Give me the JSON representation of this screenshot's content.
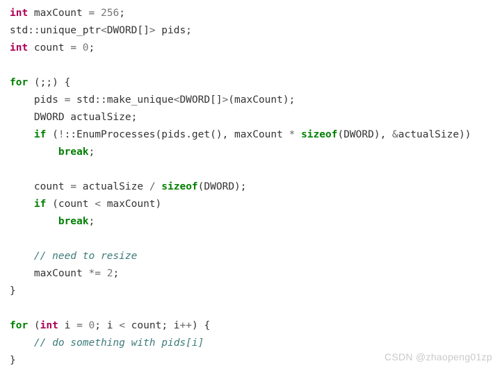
{
  "page": {
    "background_color": "#ffffff",
    "language": "cpp"
  },
  "theme": {
    "plain_color": "#333333",
    "keyword_color": "#008000",
    "type_color": "#aa0055",
    "number_color": "#777777",
    "operator_color": "#666666",
    "comment_color": "#3d7b7b",
    "watermark_color": "#c9c9c9"
  },
  "code": {
    "lines": [
      {
        "index": 0,
        "text": "int maxCount = 256;",
        "tokens": [
          {
            "t": "int",
            "k": "type"
          },
          {
            "t": " maxCount ",
            "k": "plain"
          },
          {
            "t": "=",
            "k": "operator"
          },
          {
            "t": " ",
            "k": "plain"
          },
          {
            "t": "256",
            "k": "number"
          },
          {
            "t": ";",
            "k": "punct"
          }
        ]
      },
      {
        "index": 1,
        "text": "std::unique_ptr<DWORD[]> pids;",
        "tokens": [
          {
            "t": "std::unique_ptr",
            "k": "plain"
          },
          {
            "t": "<",
            "k": "operator"
          },
          {
            "t": "DWORD[]",
            "k": "plain"
          },
          {
            "t": ">",
            "k": "operator"
          },
          {
            "t": " pids;",
            "k": "plain"
          }
        ]
      },
      {
        "index": 2,
        "text": "int count = 0;",
        "tokens": [
          {
            "t": "int",
            "k": "type"
          },
          {
            "t": " count ",
            "k": "plain"
          },
          {
            "t": "=",
            "k": "operator"
          },
          {
            "t": " ",
            "k": "plain"
          },
          {
            "t": "0",
            "k": "number"
          },
          {
            "t": ";",
            "k": "punct"
          }
        ]
      },
      {
        "index": 3,
        "text": "",
        "tokens": []
      },
      {
        "index": 4,
        "text": "for (;;) {",
        "tokens": [
          {
            "t": "for",
            "k": "keyword"
          },
          {
            "t": " (;;) {",
            "k": "plain"
          }
        ]
      },
      {
        "index": 5,
        "text": "    pids = std::make_unique<DWORD[]>(maxCount);",
        "tokens": [
          {
            "t": "    pids ",
            "k": "plain"
          },
          {
            "t": "=",
            "k": "operator"
          },
          {
            "t": " std::make_unique",
            "k": "plain"
          },
          {
            "t": "<",
            "k": "operator"
          },
          {
            "t": "DWORD[]",
            "k": "plain"
          },
          {
            "t": ">",
            "k": "operator"
          },
          {
            "t": "(maxCount);",
            "k": "plain"
          }
        ]
      },
      {
        "index": 6,
        "text": "    DWORD actualSize;",
        "tokens": [
          {
            "t": "    DWORD actualSize;",
            "k": "plain"
          }
        ]
      },
      {
        "index": 7,
        "text": "    if (!::EnumProcesses(pids.get(), maxCount * sizeof(DWORD), &actualSize))",
        "tokens": [
          {
            "t": "    ",
            "k": "plain"
          },
          {
            "t": "if",
            "k": "keyword"
          },
          {
            "t": " (",
            "k": "plain"
          },
          {
            "t": "!",
            "k": "operator"
          },
          {
            "t": "::EnumProcesses(pids.get(), maxCount ",
            "k": "plain"
          },
          {
            "t": "*",
            "k": "operator"
          },
          {
            "t": " ",
            "k": "plain"
          },
          {
            "t": "sizeof",
            "k": "keyword"
          },
          {
            "t": "(DWORD), ",
            "k": "plain"
          },
          {
            "t": "&",
            "k": "operator"
          },
          {
            "t": "actualSize))",
            "k": "plain"
          }
        ]
      },
      {
        "index": 8,
        "text": "        break;",
        "tokens": [
          {
            "t": "        ",
            "k": "plain"
          },
          {
            "t": "break",
            "k": "keyword"
          },
          {
            "t": ";",
            "k": "punct"
          }
        ]
      },
      {
        "index": 9,
        "text": "",
        "tokens": []
      },
      {
        "index": 10,
        "text": "    count = actualSize / sizeof(DWORD);",
        "tokens": [
          {
            "t": "    count ",
            "k": "plain"
          },
          {
            "t": "=",
            "k": "operator"
          },
          {
            "t": " actualSize ",
            "k": "plain"
          },
          {
            "t": "/",
            "k": "operator"
          },
          {
            "t": " ",
            "k": "plain"
          },
          {
            "t": "sizeof",
            "k": "keyword"
          },
          {
            "t": "(DWORD);",
            "k": "plain"
          }
        ]
      },
      {
        "index": 11,
        "text": "    if (count < maxCount)",
        "tokens": [
          {
            "t": "    ",
            "k": "plain"
          },
          {
            "t": "if",
            "k": "keyword"
          },
          {
            "t": " (count ",
            "k": "plain"
          },
          {
            "t": "<",
            "k": "operator"
          },
          {
            "t": " maxCount)",
            "k": "plain"
          }
        ]
      },
      {
        "index": 12,
        "text": "        break;",
        "tokens": [
          {
            "t": "        ",
            "k": "plain"
          },
          {
            "t": "break",
            "k": "keyword"
          },
          {
            "t": ";",
            "k": "punct"
          }
        ]
      },
      {
        "index": 13,
        "text": "",
        "tokens": []
      },
      {
        "index": 14,
        "text": "    // need to resize",
        "tokens": [
          {
            "t": "    ",
            "k": "plain"
          },
          {
            "t": "// need to resize",
            "k": "comment"
          }
        ]
      },
      {
        "index": 15,
        "text": "    maxCount *= 2;",
        "tokens": [
          {
            "t": "    maxCount ",
            "k": "plain"
          },
          {
            "t": "*=",
            "k": "operator"
          },
          {
            "t": " ",
            "k": "plain"
          },
          {
            "t": "2",
            "k": "number"
          },
          {
            "t": ";",
            "k": "punct"
          }
        ]
      },
      {
        "index": 16,
        "text": "}",
        "tokens": [
          {
            "t": "}",
            "k": "plain"
          }
        ]
      },
      {
        "index": 17,
        "text": "",
        "tokens": []
      },
      {
        "index": 18,
        "text": "for (int i = 0; i < count; i++) {",
        "tokens": [
          {
            "t": "for",
            "k": "keyword"
          },
          {
            "t": " (",
            "k": "plain"
          },
          {
            "t": "int",
            "k": "type"
          },
          {
            "t": " i ",
            "k": "plain"
          },
          {
            "t": "=",
            "k": "operator"
          },
          {
            "t": " ",
            "k": "plain"
          },
          {
            "t": "0",
            "k": "number"
          },
          {
            "t": "; i ",
            "k": "plain"
          },
          {
            "t": "<",
            "k": "operator"
          },
          {
            "t": " count; i",
            "k": "plain"
          },
          {
            "t": "++",
            "k": "operator"
          },
          {
            "t": ") {",
            "k": "plain"
          }
        ]
      },
      {
        "index": 19,
        "text": "    // do something with pids[i]",
        "tokens": [
          {
            "t": "    ",
            "k": "plain"
          },
          {
            "t": "// do something with pids[i]",
            "k": "comment"
          }
        ]
      },
      {
        "index": 20,
        "text": "}",
        "tokens": [
          {
            "t": "}",
            "k": "plain"
          }
        ]
      }
    ]
  },
  "watermark": {
    "text": "CSDN @zhaopeng01zp"
  }
}
